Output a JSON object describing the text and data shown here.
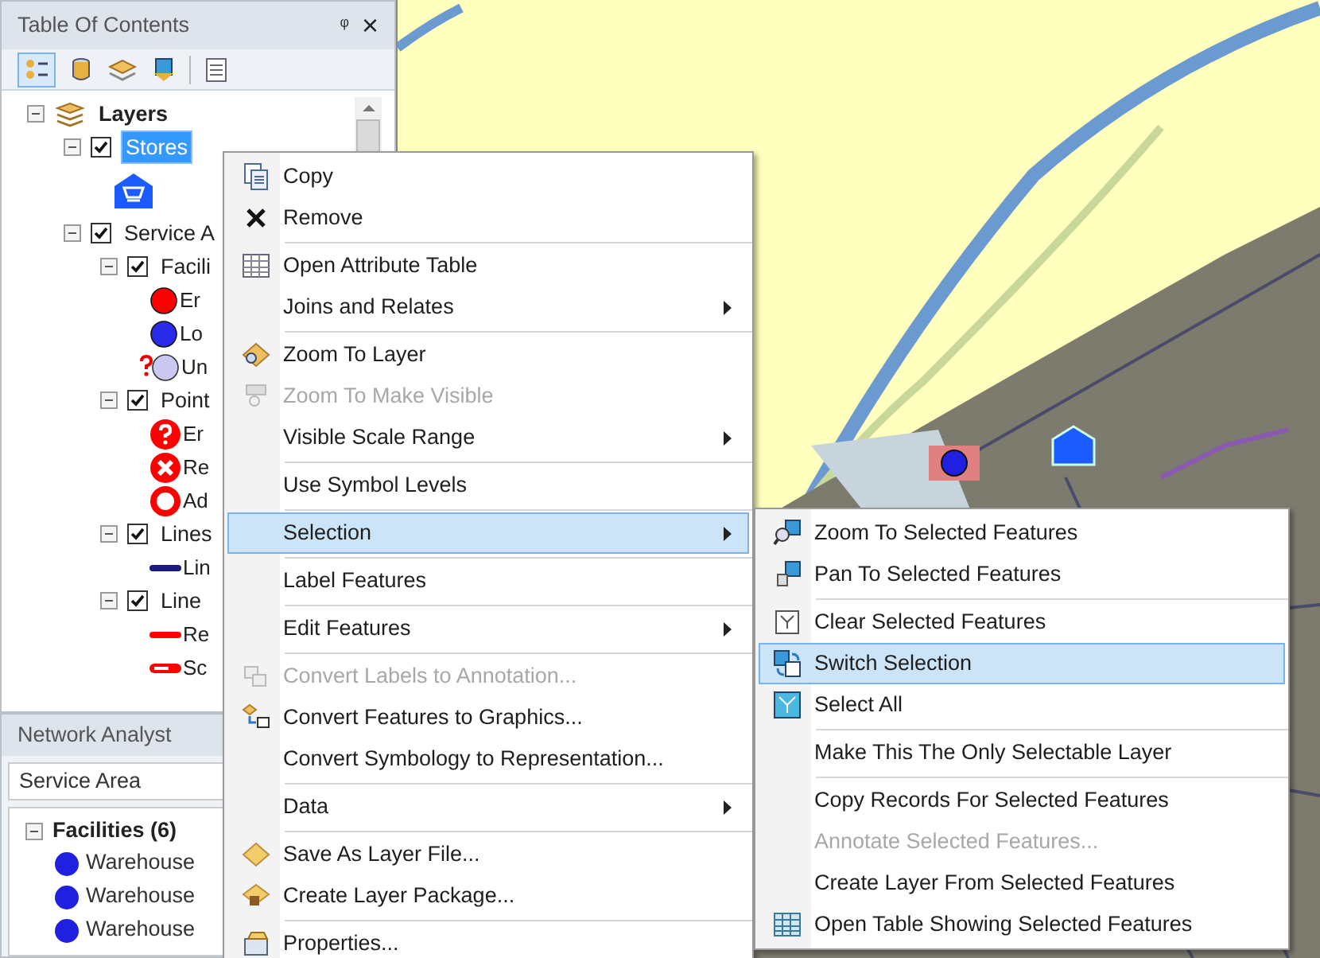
{
  "toc": {
    "title": "Table Of Contents",
    "pin": "ᵠ",
    "close": "×",
    "tree": [
      {
        "kind": "group",
        "label": "Layers",
        "expanded": true,
        "bold": true,
        "children": [
          {
            "kind": "layer",
            "label": "Stores",
            "checked": true,
            "expanded": true,
            "selected": true,
            "children": [
              {
                "kind": "store",
                "color": "#1a5cff"
              }
            ]
          },
          {
            "kind": "layer",
            "label": "Service A",
            "checked": true,
            "expanded": true,
            "selected": false,
            "children": [
              {
                "kind": "layer",
                "label": "Facili",
                "checked": true,
                "expanded": true,
                "selected": false,
                "children": [
                  {
                    "kind": "circle",
                    "label": "Er",
                    "color": "#ff0000"
                  },
                  {
                    "kind": "circle",
                    "label": "Lo",
                    "color": "#2a2ae8"
                  },
                  {
                    "kind": "unknown",
                    "label": "Un",
                    "color": "#c8c8f0"
                  }
                ]
              },
              {
                "kind": "layer",
                "label": "Point",
                "checked": true,
                "expanded": true,
                "selected": false,
                "children": [
                  {
                    "kind": "error",
                    "label": "Er",
                    "color": "#ff0000"
                  },
                  {
                    "kind": "cross",
                    "label": "Re",
                    "color": "#ff0000"
                  },
                  {
                    "kind": "ring",
                    "label": "Ad",
                    "color": "#ff0000"
                  }
                ]
              },
              {
                "kind": "layer",
                "label": "Lines",
                "checked": true,
                "expanded": true,
                "selected": false,
                "children": [
                  {
                    "kind": "line",
                    "label": "Lin",
                    "color": "#1a1a80"
                  }
                ]
              },
              {
                "kind": "layer",
                "label": "Line",
                "checked": true,
                "expanded": true,
                "selected": false,
                "children": [
                  {
                    "kind": "line",
                    "label": "Re",
                    "color": "#ff0000"
                  },
                  {
                    "kind": "outlined-line",
                    "label": "Sc",
                    "color": "#ff0000"
                  }
                ]
              }
            ]
          }
        ]
      }
    ]
  },
  "network_analyst": {
    "title": "Network Analyst",
    "analysis": "Service Area",
    "groups": [
      {
        "label": "Facilities (6)",
        "expanded": true,
        "items": [
          {
            "label": "Warehouse",
            "color": "#2020e0"
          },
          {
            "label": "Warehouse",
            "color": "#2020e0"
          },
          {
            "label": "Warehouse",
            "color": "#2020e0"
          }
        ]
      }
    ]
  },
  "context_menu": {
    "items": [
      {
        "kind": "item",
        "label": "Copy",
        "disabled": false,
        "submenu": false,
        "selected": false
      },
      {
        "kind": "item",
        "label": "Remove",
        "disabled": false,
        "submenu": false,
        "selected": false
      },
      {
        "kind": "separator"
      },
      {
        "kind": "item",
        "label": "Open Attribute Table",
        "disabled": false,
        "submenu": false,
        "selected": false
      },
      {
        "kind": "item",
        "label": "Joins and Relates",
        "disabled": false,
        "submenu": true,
        "selected": false
      },
      {
        "kind": "separator"
      },
      {
        "kind": "item",
        "label": "Zoom To Layer",
        "disabled": false,
        "submenu": false,
        "selected": false
      },
      {
        "kind": "item",
        "label": "Zoom To Make Visible",
        "disabled": true,
        "submenu": false,
        "selected": false
      },
      {
        "kind": "item",
        "label": "Visible Scale Range",
        "disabled": false,
        "submenu": true,
        "selected": false
      },
      {
        "kind": "separator"
      },
      {
        "kind": "item",
        "label": "Use Symbol Levels",
        "disabled": false,
        "submenu": false,
        "selected": false
      },
      {
        "kind": "separator"
      },
      {
        "kind": "item",
        "label": "Selection",
        "disabled": false,
        "submenu": true,
        "selected": true
      },
      {
        "kind": "separator"
      },
      {
        "kind": "item",
        "label": "Label Features",
        "disabled": false,
        "submenu": false,
        "selected": false
      },
      {
        "kind": "separator"
      },
      {
        "kind": "item",
        "label": "Edit Features",
        "disabled": false,
        "submenu": true,
        "selected": false
      },
      {
        "kind": "separator"
      },
      {
        "kind": "item",
        "label": "Convert Labels to Annotation...",
        "disabled": true,
        "submenu": false,
        "selected": false
      },
      {
        "kind": "item",
        "label": "Convert Features to Graphics...",
        "disabled": false,
        "submenu": false,
        "selected": false
      },
      {
        "kind": "item",
        "label": "Convert Symbology to Representation...",
        "disabled": false,
        "submenu": false,
        "selected": false
      },
      {
        "kind": "separator"
      },
      {
        "kind": "item",
        "label": "Data",
        "disabled": false,
        "submenu": true,
        "selected": false
      },
      {
        "kind": "separator"
      },
      {
        "kind": "item",
        "label": "Save As Layer File...",
        "disabled": false,
        "submenu": false,
        "selected": false
      },
      {
        "kind": "item",
        "label": "Create Layer Package...",
        "disabled": false,
        "submenu": false,
        "selected": false
      },
      {
        "kind": "separator"
      },
      {
        "kind": "item",
        "label": "Properties...",
        "disabled": false,
        "submenu": false,
        "selected": false
      }
    ]
  },
  "selection_submenu": {
    "items": [
      {
        "kind": "item",
        "label": "Zoom To Selected Features",
        "disabled": false,
        "selected": false
      },
      {
        "kind": "item",
        "label": "Pan To Selected Features",
        "disabled": false,
        "selected": false
      },
      {
        "kind": "separator"
      },
      {
        "kind": "item",
        "label": "Clear Selected Features",
        "disabled": false,
        "selected": false
      },
      {
        "kind": "item",
        "label": "Switch Selection",
        "disabled": false,
        "selected": true
      },
      {
        "kind": "item",
        "label": "Select All",
        "disabled": false,
        "selected": false
      },
      {
        "kind": "separator"
      },
      {
        "kind": "item",
        "label": "Make This The Only Selectable Layer",
        "disabled": false,
        "selected": false
      },
      {
        "kind": "separator"
      },
      {
        "kind": "item",
        "label": "Copy Records For Selected Features",
        "disabled": false,
        "selected": false
      },
      {
        "kind": "item",
        "label": "Annotate Selected Features...",
        "disabled": true,
        "selected": false
      },
      {
        "kind": "item",
        "label": "Create Layer From Selected Features",
        "disabled": false,
        "selected": false
      },
      {
        "kind": "item",
        "label": "Open Table Showing Selected Features",
        "disabled": false,
        "selected": false
      }
    ]
  }
}
